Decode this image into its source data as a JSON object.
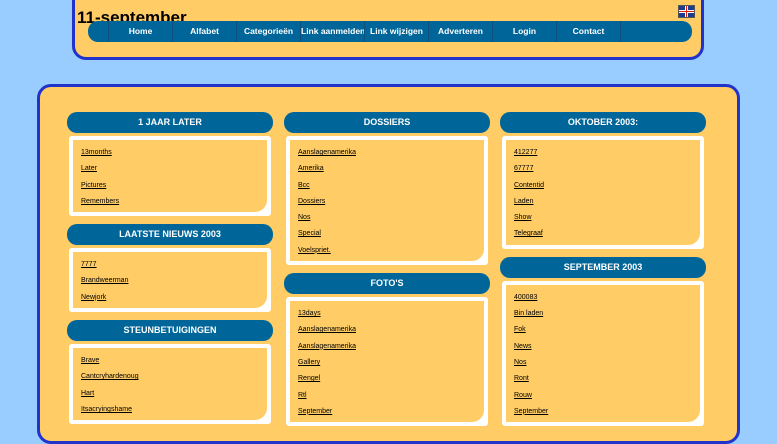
{
  "header": {
    "title": "11-september",
    "flag_icon": "uk-flag-icon"
  },
  "nav": [
    "Home",
    "Alfabet",
    "Categorieën",
    "Link aanmelden",
    "Link wijzigen",
    "Adverteren",
    "Login",
    "Contact"
  ],
  "sections": {
    "jaar_later": {
      "title": "1 JAAR LATER",
      "links": [
        "13months",
        "Later",
        "Pictures",
        "Remembers"
      ]
    },
    "nieuws": {
      "title": "LAATSTE NIEUWS 2003",
      "links": [
        "7777",
        "Brandweerman",
        "Newjork"
      ]
    },
    "steun": {
      "title": "STEUNBETUIGINGEN",
      "links": [
        "Brave",
        "Cantcryhardenoug",
        "Hart",
        "Itsacryingshame"
      ]
    },
    "dossiers": {
      "title": "DOSSIERS",
      "links": [
        "Aanslagenamerika",
        "Amerika",
        "Bcc",
        "Dossiers",
        "Nos",
        "Special",
        "Voelspriet."
      ]
    },
    "fotos": {
      "title": "FOTO'S",
      "links": [
        "13days",
        "Aanslagenamerika",
        "Aanslagenamerika",
        "Gallery",
        "Rengel",
        "Rtl",
        "September"
      ]
    },
    "oktober": {
      "title": "OKTOBER 2003:",
      "links": [
        "412277",
        "67777",
        "Contentid",
        "Laden",
        "Show",
        "Telegraaf"
      ]
    },
    "september": {
      "title": "SEPTEMBER 2003",
      "links": [
        "400083",
        "Bin laden",
        "Fok",
        "News",
        "Nos",
        "Ront",
        "Rouw",
        "September"
      ]
    }
  }
}
